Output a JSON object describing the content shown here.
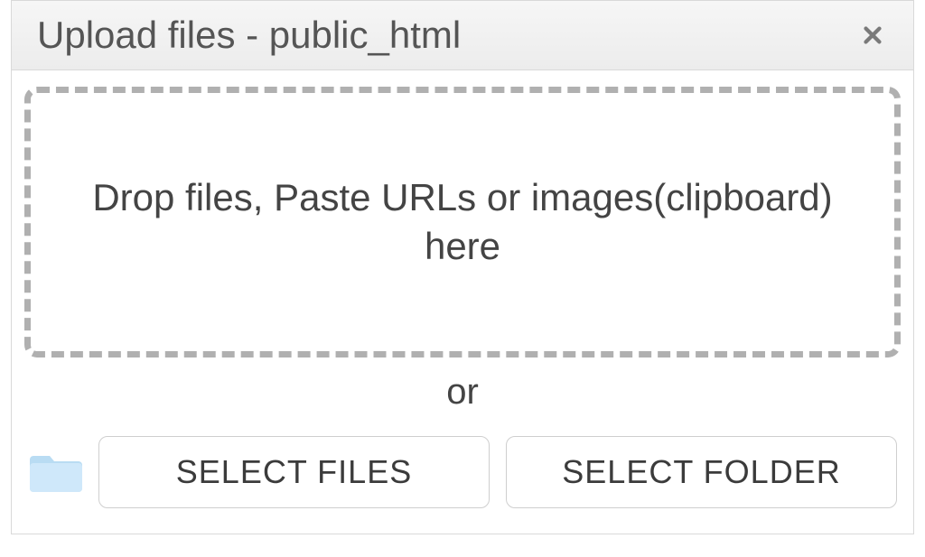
{
  "dialog": {
    "title": "Upload files - public_html"
  },
  "dropzone": {
    "text": "Drop files, Paste URLs or images(clipboard) here"
  },
  "separator": {
    "label": "or"
  },
  "actions": {
    "select_files_label": "SELECT FILES",
    "select_folder_label": "SELECT FOLDER"
  }
}
